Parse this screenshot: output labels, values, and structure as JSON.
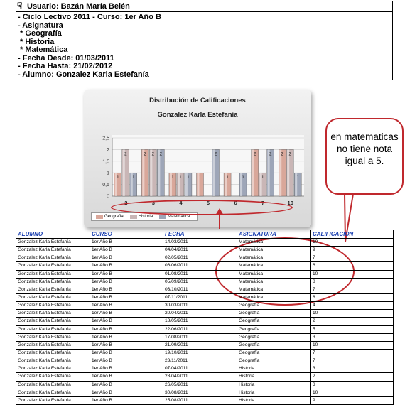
{
  "header": {
    "user": "Usuario: Bazán María Belén",
    "lines": [
      "- Ciclo Lectivo 2011 - Curso: 1er Año B",
      "- Asignatura",
      " * Geografía",
      " * Historia",
      " * Matemática",
      "- Fecha Desde: 01/03/2011",
      "- Fecha Hasta: 21/02/2012",
      "- Alumno: Gonzalez Karla Estefanía"
    ]
  },
  "chart_data": {
    "type": "bar",
    "title": "Distribución de Calificaciones",
    "subtitle": "Gonzalez Karla Estefanía",
    "categories": [
      "2",
      "3",
      "4",
      "5",
      "6",
      "7",
      "10"
    ],
    "series": [
      {
        "name": "Geografía",
        "values": [
          1,
          2,
          1,
          1,
          1,
          2,
          2
        ],
        "color": "#d9a79a"
      },
      {
        "name": "Historia",
        "values": [
          2,
          2,
          1,
          0,
          0,
          1,
          2
        ],
        "color": "#c9b6b6"
      },
      {
        "name": "Matemática",
        "values": [
          1,
          2,
          1,
          2,
          1,
          2,
          1
        ],
        "color": "#9ea6b8"
      }
    ],
    "yticks": [
      "0",
      "0,5",
      "1",
      "1,5",
      "2",
      "2,5"
    ],
    "ylim": [
      0,
      2.5
    ],
    "grid": true,
    "legend": "bottom-left"
  },
  "annotation": {
    "text": "en matematicas no tiene nota igual a 5.",
    "color": "#c0282d"
  },
  "table": {
    "headers": [
      "ALUMNO",
      "CURSO",
      "FECHA",
      "ASIGNATURA",
      "CALIFICACION"
    ],
    "rows": [
      [
        "Gonzalez Karla Estefanía",
        "1er Año B",
        "14/03/2011",
        "Matemática",
        "10"
      ],
      [
        "Gonzalez Karla Estefanía",
        "1er Año B",
        "04/04/2011",
        "Matemática",
        "9"
      ],
      [
        "Gonzalez Karla Estefanía",
        "1er Año B",
        "02/05/2011",
        "Matemática",
        "7"
      ],
      [
        "Gonzalez Karla Estefanía",
        "1er Año B",
        "06/06/2011",
        "Matemática",
        "6"
      ],
      [
        "Gonzalez Karla Estefanía",
        "1er Año B",
        "01/08/2011",
        "Matemática",
        "10"
      ],
      [
        "Gonzalez Karla Estefanía",
        "1er Año B",
        "05/09/2011",
        "Matemática",
        "8"
      ],
      [
        "Gonzalez Karla Estefanía",
        "1er Año B",
        "03/10/2011",
        "Matemática",
        "7"
      ],
      [
        "Gonzalez Karla Estefanía",
        "1er Año B",
        "07/11/2011",
        "Matemática",
        "8"
      ],
      [
        "Gonzalez Karla Estefanía",
        "1er Año B",
        "30/03/2011",
        "Geografía",
        "4"
      ],
      [
        "Gonzalez Karla Estefanía",
        "1er Año B",
        "20/04/2011",
        "Geografía",
        "10"
      ],
      [
        "Gonzalez Karla Estefanía",
        "1er Año B",
        "18/05/2011",
        "Geografía",
        "2"
      ],
      [
        "Gonzalez Karla Estefanía",
        "1er Año B",
        "22/06/2011",
        "Geografía",
        "5"
      ],
      [
        "Gonzalez Karla Estefanía",
        "1er Año B",
        "17/08/2011",
        "Geografía",
        "3"
      ],
      [
        "Gonzalez Karla Estefanía",
        "1er Año B",
        "21/09/2011",
        "Geografía",
        "10"
      ],
      [
        "Gonzalez Karla Estefanía",
        "1er Año B",
        "19/10/2011",
        "Geografía",
        "7"
      ],
      [
        "Gonzalez Karla Estefanía",
        "1er Año B",
        "23/11/2011",
        "Geografía",
        "7"
      ],
      [
        "Gonzalez Karla Estefanía",
        "1er Año B",
        "07/04/2011",
        "Historia",
        "3"
      ],
      [
        "Gonzalez Karla Estefanía",
        "1er Año B",
        "28/04/2011",
        "Historia",
        "2"
      ],
      [
        "Gonzalez Karla Estefanía",
        "1er Año B",
        "26/05/2011",
        "Historia",
        "3"
      ],
      [
        "Gonzalez Karla Estefanía",
        "1er Año B",
        "30/08/2011",
        "Historia",
        "10"
      ],
      [
        "Gonzalez Karla Estefanía",
        "1er Año B",
        "25/08/2011",
        "Historia",
        "9"
      ]
    ]
  }
}
